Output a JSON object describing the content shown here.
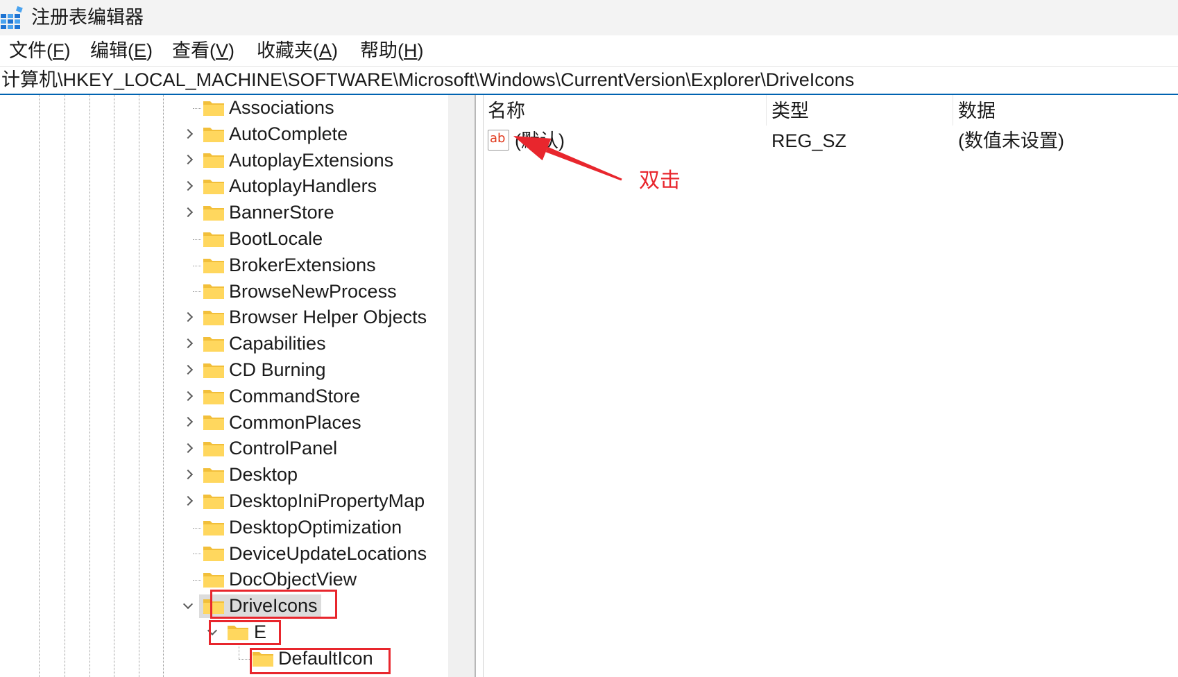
{
  "window": {
    "title": "注册表编辑器",
    "app_icon": "registry-editor-icon"
  },
  "menu": {
    "items": [
      {
        "pre": "文件(",
        "key": "F",
        "post": ")"
      },
      {
        "pre": "编辑(",
        "key": "E",
        "post": ")"
      },
      {
        "pre": "查看(",
        "key": "V",
        "post": ")"
      },
      {
        "pre": "收藏夹(",
        "key": "A",
        "post": ")"
      },
      {
        "pre": "帮助(",
        "key": "H",
        "post": ")"
      }
    ]
  },
  "address": {
    "path": "计算机\\HKEY_LOCAL_MACHINE\\SOFTWARE\\Microsoft\\Windows\\CurrentVersion\\Explorer\\DriveIcons"
  },
  "tree": {
    "items": [
      {
        "label": "Associations",
        "level": 0,
        "expander": "none"
      },
      {
        "label": "AutoComplete",
        "level": 0,
        "expander": "collapsed"
      },
      {
        "label": "AutoplayExtensions",
        "level": 0,
        "expander": "collapsed"
      },
      {
        "label": "AutoplayHandlers",
        "level": 0,
        "expander": "collapsed"
      },
      {
        "label": "BannerStore",
        "level": 0,
        "expander": "collapsed"
      },
      {
        "label": "BootLocale",
        "level": 0,
        "expander": "none"
      },
      {
        "label": "BrokerExtensions",
        "level": 0,
        "expander": "none"
      },
      {
        "label": "BrowseNewProcess",
        "level": 0,
        "expander": "none"
      },
      {
        "label": "Browser Helper Objects",
        "level": 0,
        "expander": "collapsed"
      },
      {
        "label": "Capabilities",
        "level": 0,
        "expander": "collapsed"
      },
      {
        "label": "CD Burning",
        "level": 0,
        "expander": "collapsed"
      },
      {
        "label": "CommandStore",
        "level": 0,
        "expander": "collapsed"
      },
      {
        "label": "CommonPlaces",
        "level": 0,
        "expander": "collapsed"
      },
      {
        "label": "ControlPanel",
        "level": 0,
        "expander": "collapsed"
      },
      {
        "label": "Desktop",
        "level": 0,
        "expander": "collapsed"
      },
      {
        "label": "DesktopIniPropertyMap",
        "level": 0,
        "expander": "collapsed"
      },
      {
        "label": "DesktopOptimization",
        "level": 0,
        "expander": "none"
      },
      {
        "label": "DeviceUpdateLocations",
        "level": 0,
        "expander": "none"
      },
      {
        "label": "DocObjectView",
        "level": 0,
        "expander": "none"
      },
      {
        "label": "DriveIcons",
        "level": 0,
        "expander": "expanded",
        "selected": true,
        "highlighted": true
      },
      {
        "label": "E",
        "level": 1,
        "expander": "expanded",
        "highlighted": true
      },
      {
        "label": "DefaultIcon",
        "level": 2,
        "expander": "none",
        "highlighted": true
      }
    ]
  },
  "values": {
    "columns": {
      "name": "名称",
      "type": "类型",
      "data": "数据"
    },
    "rows": [
      {
        "icon": "string-value-icon",
        "icon_text": "ab",
        "name": "(默认)",
        "type": "REG_SZ",
        "data": "(数值未设置)"
      }
    ]
  },
  "annotation": {
    "callout_text": "双击"
  },
  "colors": {
    "accent": "#0063b1",
    "annotation": "#e8262d",
    "folder_back": "#f2bf3a",
    "folder_front": "#ffd75e",
    "selection": "#dcdcdc",
    "string_icon_text": "#e03a1e"
  }
}
